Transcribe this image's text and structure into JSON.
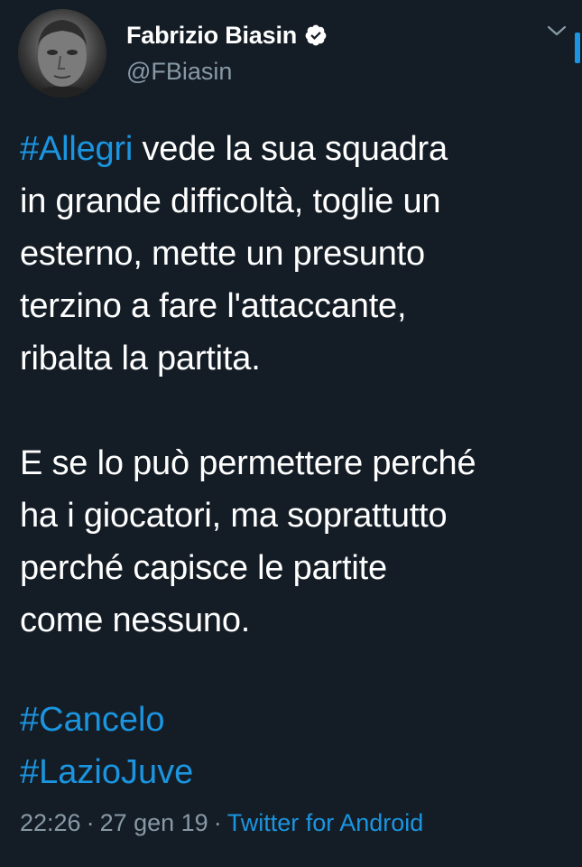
{
  "author": {
    "display_name": "Fabrizio Biasin",
    "handle": "@FBiasin",
    "verified": true
  },
  "tweet": {
    "paragraph1_hashtag": "#Allegri",
    "paragraph1_lines": [
      " vede la sua squadra",
      "in grande difficoltà, toglie un",
      "esterno, mette un presunto",
      "terzino a fare l'attaccante,",
      "ribalta la partita."
    ],
    "paragraph2_lines": [
      "E se lo può permettere perché",
      "ha i giocatori, ma soprattutto",
      "perché capisce le partite",
      "come nessuno."
    ],
    "hashtags": [
      "#Cancelo",
      "#LazioJuve"
    ]
  },
  "meta": {
    "time": "22:26",
    "separator": "·",
    "date": "27 gen 19",
    "source": "Twitter for Android"
  },
  "icons": {
    "verified": "verified-badge-icon",
    "menu": "chevron-down-icon"
  },
  "colors": {
    "background": "#141d26",
    "link": "#1b95e0",
    "secondary_text": "#8899a6"
  }
}
